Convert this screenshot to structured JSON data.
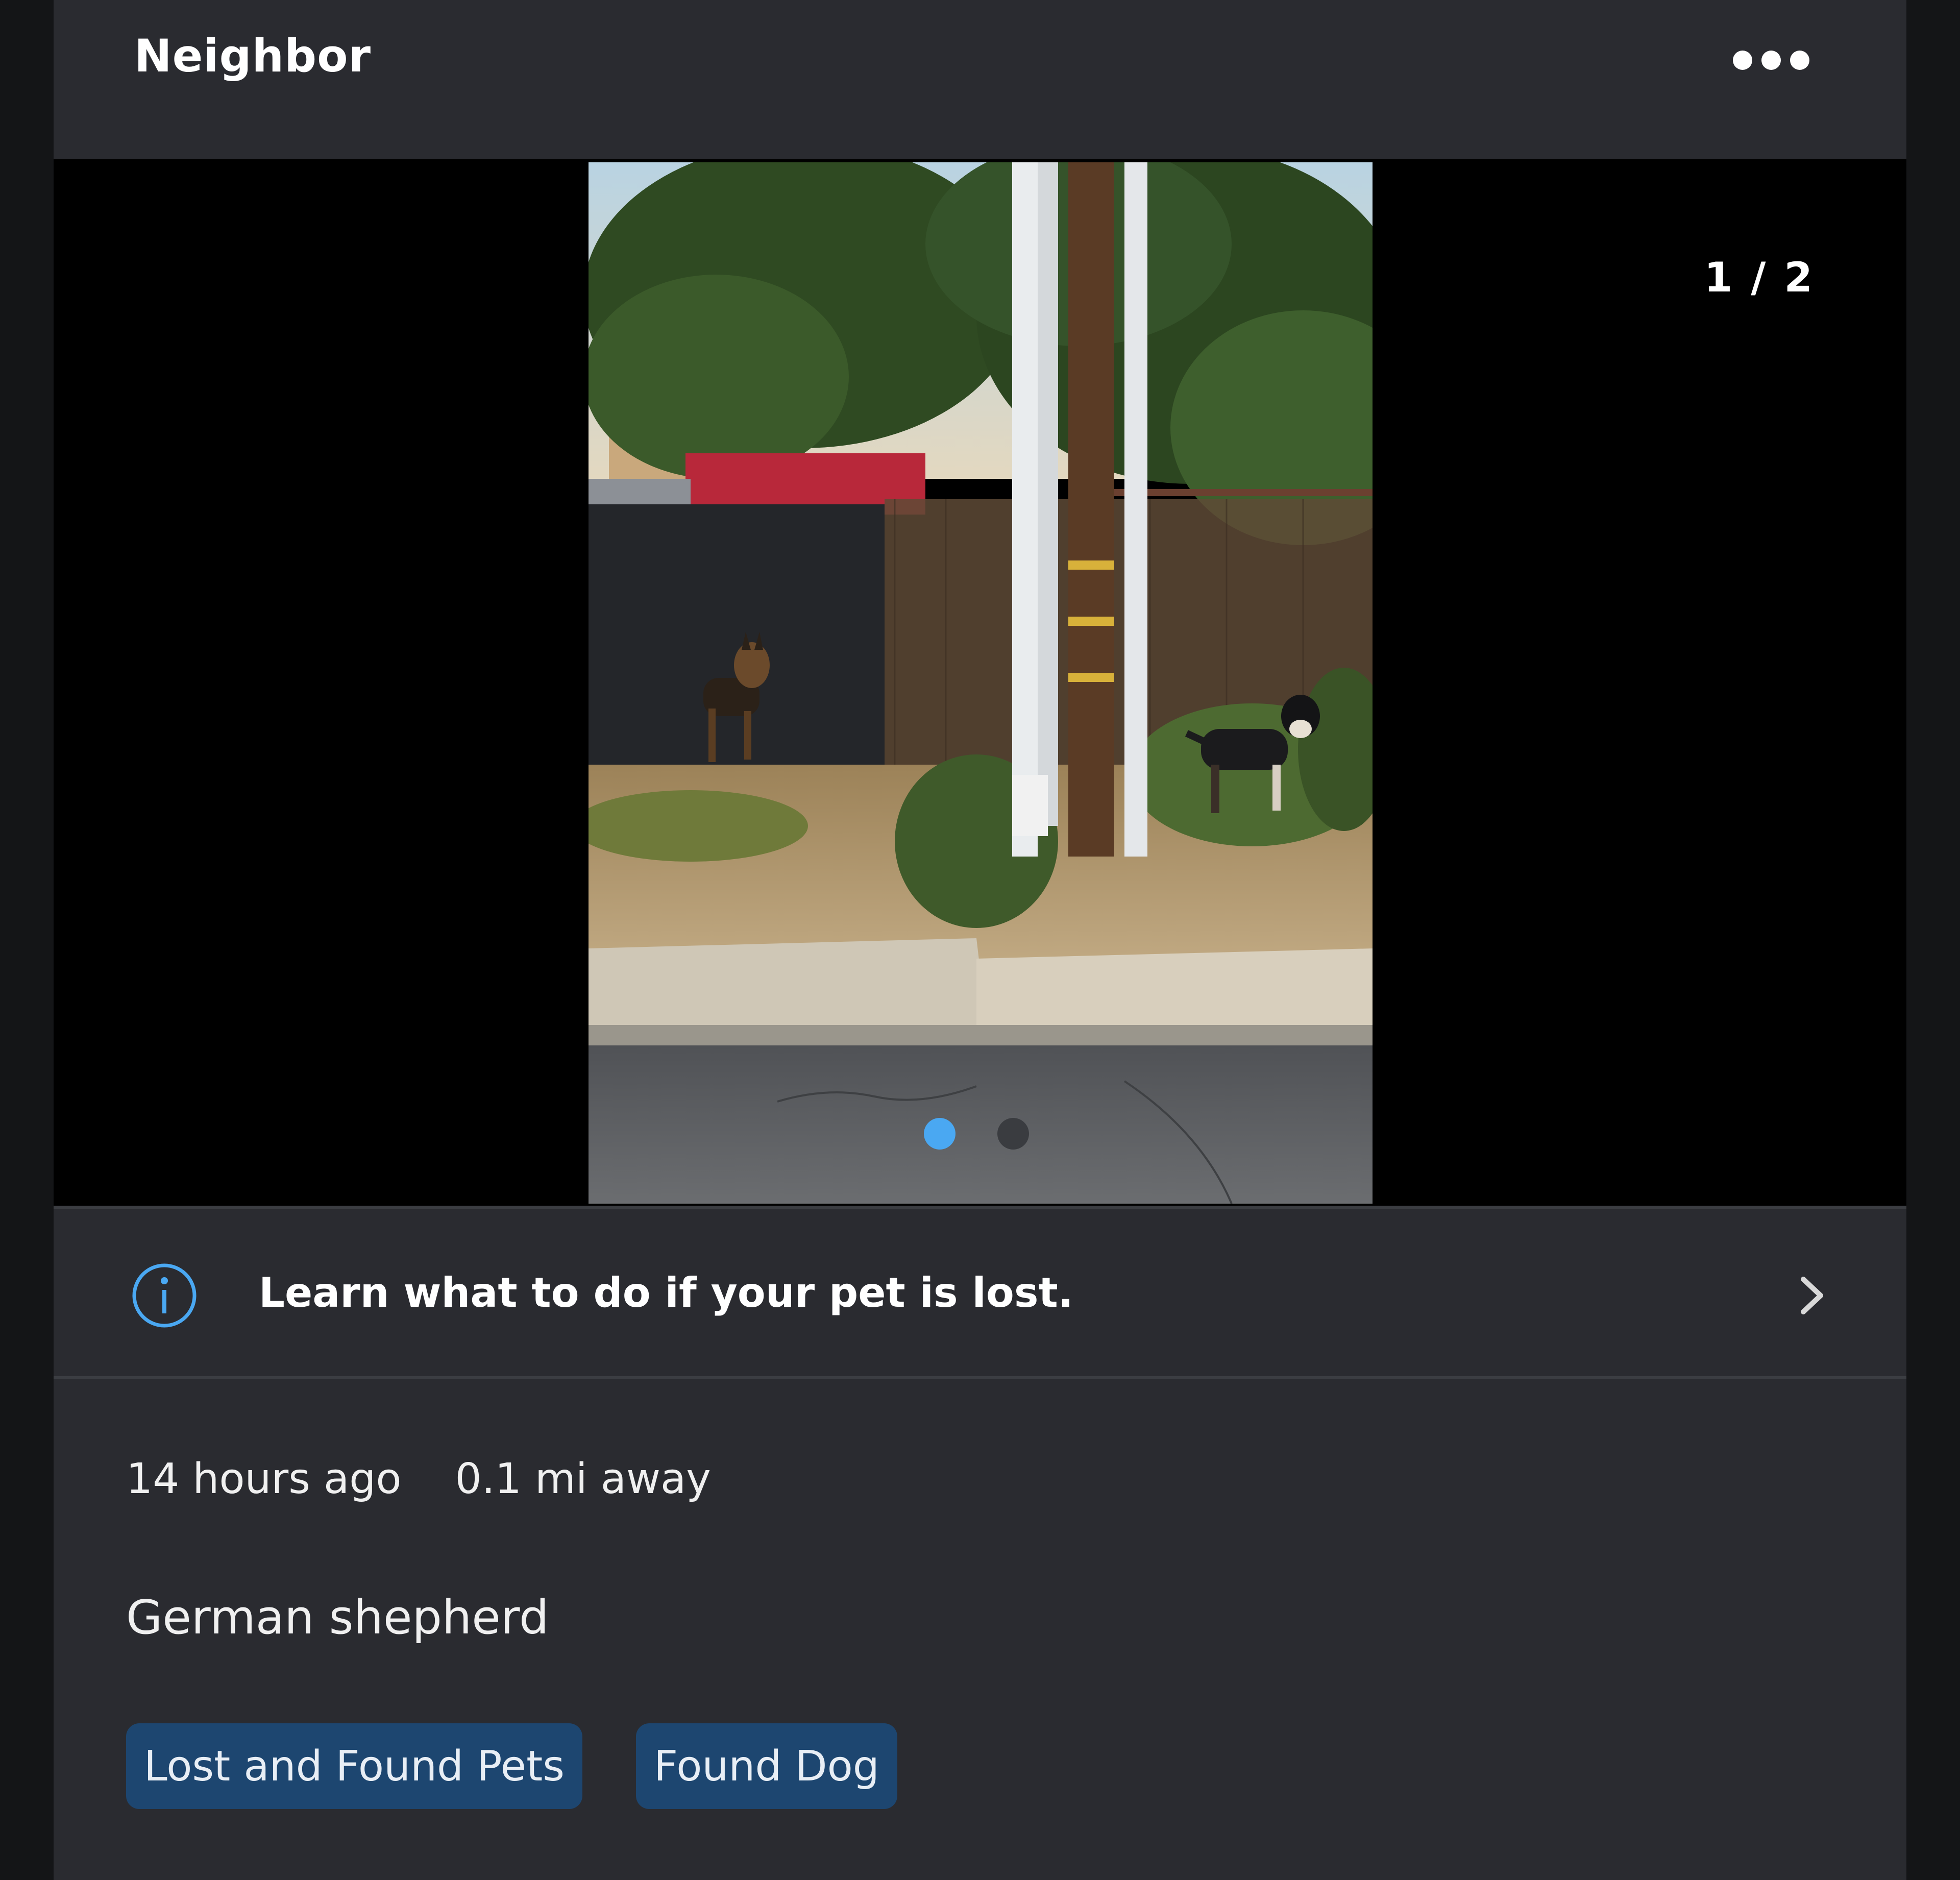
{
  "header": {
    "title": "Neighbor",
    "more_icon": "more-horizontal-icon"
  },
  "media": {
    "counter": "1 / 2",
    "current_page": 1,
    "total_pages": 2,
    "photo_alt": "photo",
    "colors": {
      "active_dot": "#4aa8f2",
      "inactive_dot": "#3a3c40"
    }
  },
  "info_banner": {
    "icon": "info-icon",
    "text": "Learn what to do if your pet is lost.",
    "chevron": "chevron-right-icon"
  },
  "post": {
    "time": "14 hours ago",
    "distance": "0.1 mi away",
    "description": "German shepherd",
    "tags": [
      "Lost and Found Pets",
      "Found Dog"
    ],
    "tag_color": "#1d4670"
  }
}
